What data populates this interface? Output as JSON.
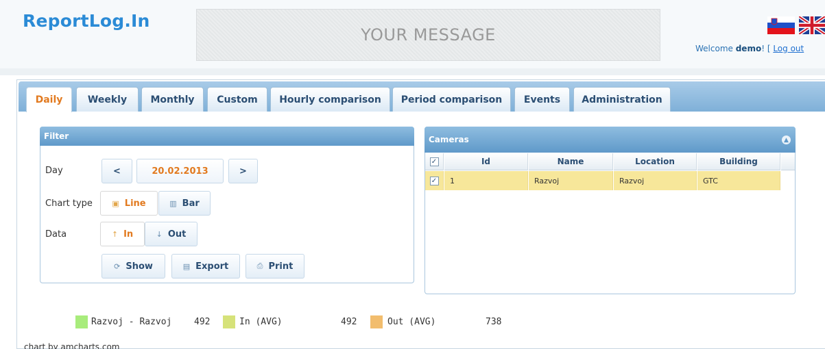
{
  "header": {
    "logo": "ReportLog.In",
    "message": "YOUR MESSAGE",
    "welcome_prefix": "Welcome ",
    "user": "demo",
    "welcome_mid": "! [ ",
    "logout": "Log out"
  },
  "tabs": [
    {
      "label": "Daily",
      "active": true
    },
    {
      "label": "Weekly",
      "active": false
    },
    {
      "label": "Monthly",
      "active": false
    },
    {
      "label": "Custom",
      "active": false
    },
    {
      "label": "Hourly comparison",
      "active": false
    },
    {
      "label": "Period comparison",
      "active": false
    },
    {
      "label": "Events",
      "active": false
    },
    {
      "label": "Administration",
      "active": false
    }
  ],
  "filter": {
    "title": "Filter",
    "day_label": "Day",
    "prev": "<",
    "date": "20.02.2013",
    "next": ">",
    "chart_type_label": "Chart type",
    "line": "Line",
    "bar": "Bar",
    "data_label": "Data",
    "in": "In",
    "out": "Out",
    "show": "Show",
    "export": "Export",
    "print": "Print"
  },
  "cameras": {
    "title": "Cameras",
    "columns": [
      "Id",
      "Name",
      "Location",
      "Building"
    ],
    "rows": [
      {
        "checked": true,
        "id": "1",
        "name": "Razvoj",
        "location": "Razvoj",
        "building": "GTC"
      }
    ]
  },
  "legend": [
    {
      "label": "Razvoj - Razvoj",
      "value": "492",
      "color": "#a8ec7c"
    },
    {
      "label": "In (AVG)",
      "value": "492",
      "color": "#d6e27a"
    },
    {
      "label": "Out (AVG)",
      "value": "738",
      "color": "#f2bd6e"
    }
  ],
  "credit": "chart by amcharts.com",
  "colors": {
    "accent": "#e27a1f",
    "brand": "#2b8bd6",
    "selected_row": "#f7e79a"
  }
}
